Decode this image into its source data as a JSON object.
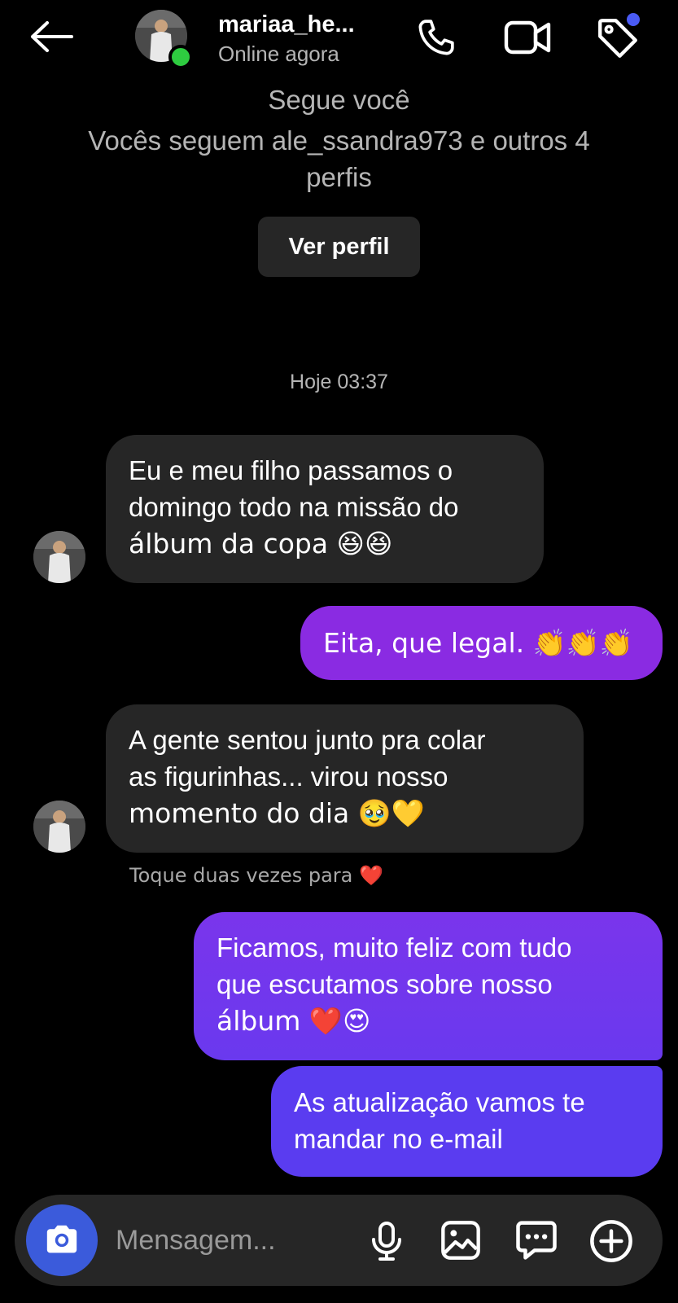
{
  "header": {
    "username": "mariaa_he...",
    "status": "Online agora",
    "icons": [
      "back-arrow-icon",
      "phone-icon",
      "video-icon",
      "tag-icon"
    ]
  },
  "profile_info": {
    "follows_you": "Segue você",
    "mutual_line1": "Vocês seguem ale_ssandra973 e outros 4",
    "mutual_line2": "perfis",
    "view_profile_label": "Ver perfil"
  },
  "timestamp": "Hoje 03:37",
  "messages": [
    {
      "from": "them",
      "lines": [
        "Eu e meu filho passamos o",
        "domingo todo na missão do",
        "álbum da copa 😆😆"
      ]
    },
    {
      "from": "me",
      "lines": [
        "Eita, que legal. 👏👏👏"
      ]
    },
    {
      "from": "them",
      "lines": [
        "A gente sentou junto pra colar",
        "as figurinhas... virou nosso",
        "momento do dia 🥹💛"
      ]
    },
    {
      "from": "me",
      "lines": [
        "Ficamos, muito feliz com tudo",
        "que escutamos sobre nosso",
        "álbum ❤️😍"
      ]
    },
    {
      "from": "me",
      "lines": [
        "As atualização vamos te",
        "mandar no e-mail"
      ]
    }
  ],
  "double_tap_hint": "Toque duas vezes para ❤️",
  "composer": {
    "placeholder": "Mensagem...",
    "icons": [
      "camera-icon",
      "microphone-icon",
      "gallery-icon",
      "sticker-icon",
      "add-icon"
    ]
  },
  "colors": {
    "background": "#000000",
    "incoming_bubble": "#262626",
    "outgoing_top": "#8a2be2",
    "outgoing_bottom": "#5a3cf0",
    "camera_button": "#3b5bdb",
    "online_dot": "#2ecc40",
    "notification_dot": "#4a5bf5"
  }
}
